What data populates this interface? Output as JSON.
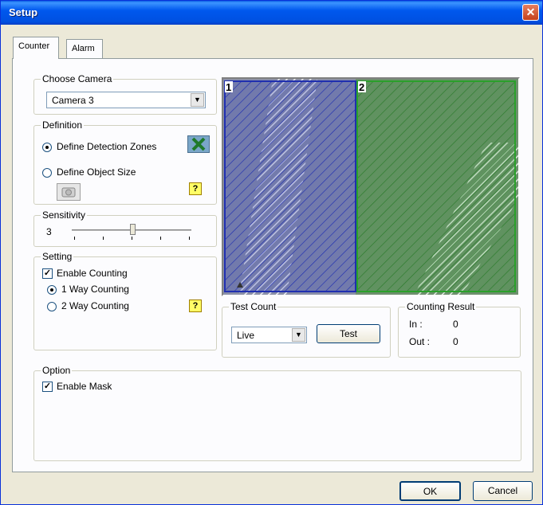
{
  "window": {
    "title": "Setup",
    "close_glyph": "✕"
  },
  "tabs": [
    {
      "label": "Counter"
    },
    {
      "label": "Alarm"
    }
  ],
  "choose_camera": {
    "group_label": "Choose Camera",
    "value": "Camera 3"
  },
  "definition": {
    "group_label": "Definition",
    "option_zones": "Define Detection Zones",
    "option_size": "Define Object Size",
    "selected": "Define Detection Zones"
  },
  "sensitivity": {
    "group_label": "Sensitivity",
    "value": "3"
  },
  "setting": {
    "group_label": "Setting",
    "enable_counting": "Enable Counting",
    "one_way": "1 Way Counting",
    "two_way": "2 Way Counting",
    "selected": "1 Way Counting",
    "enable_counting_checked": true
  },
  "preview": {
    "zone1_label": "1",
    "zone2_label": "2",
    "zone1_color": "#1f2fb0",
    "zone2_color": "#2aa02a"
  },
  "test_count": {
    "group_label": "Test Count",
    "mode": "Live",
    "test_button": "Test"
  },
  "counting_result": {
    "group_label": "Counting Result",
    "in_label": "In :",
    "in_value": "0",
    "out_label": "Out :",
    "out_value": "0"
  },
  "option": {
    "group_label": "Option",
    "enable_mask": "Enable Mask",
    "enable_mask_checked": true
  },
  "footer": {
    "ok": "OK",
    "cancel": "Cancel"
  },
  "help_glyph": "?",
  "checkbox_glyph": "✓",
  "dropdown_glyph": "▼",
  "icons": {
    "zones": "detection-zone-icon",
    "size": "object-size-icon"
  }
}
